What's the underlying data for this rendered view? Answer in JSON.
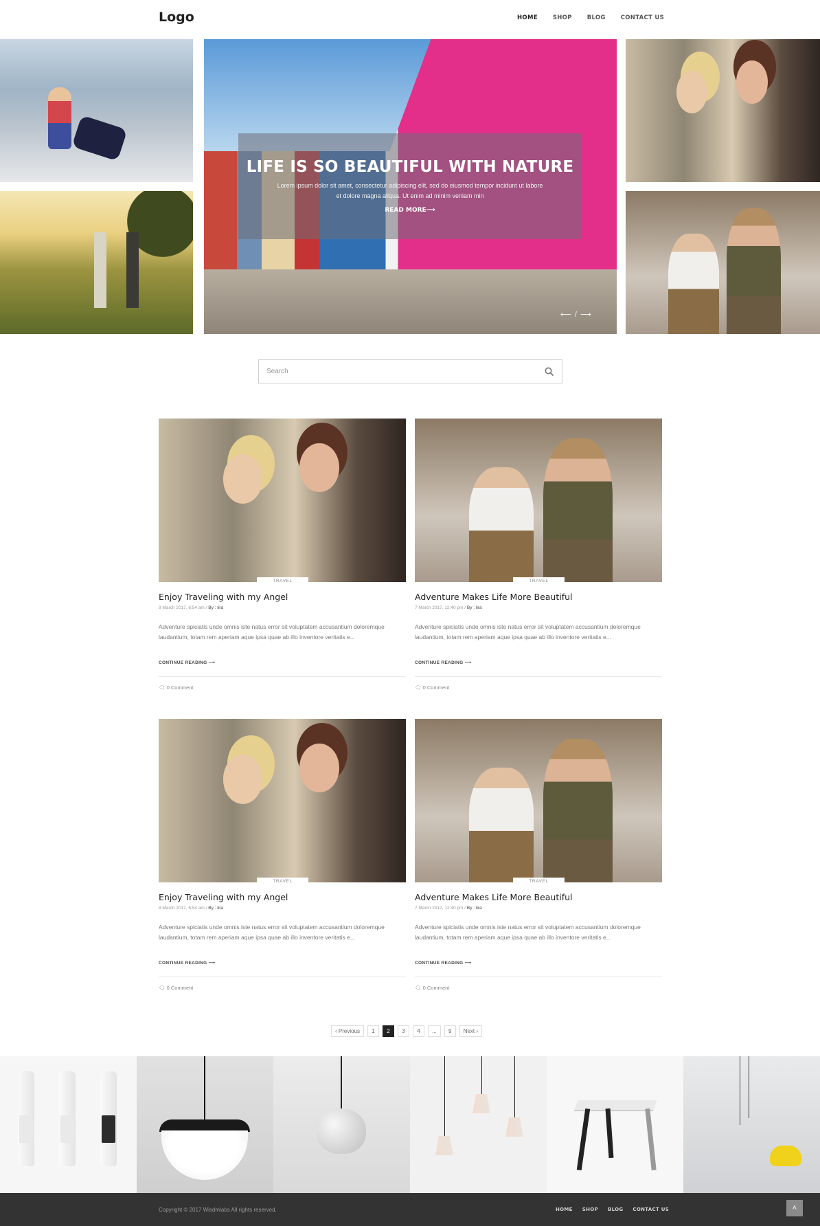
{
  "header": {
    "logo": "Logo",
    "nav": [
      "HOME",
      "SHOP",
      "BLOG",
      "CONTACT US"
    ]
  },
  "hero": {
    "title": "LIFE IS SO BEAUTIFUL WITH NATURE",
    "text": "Lorem ipsum dolor sit amet, consectetur adipiscing elit, sed do eiusmod tempor incidunt ut labore et dolore magna aliqua. Ut enim ad minim veniam min",
    "link": "READ MORE⟶",
    "arrows": "⟵ / ⟶"
  },
  "search": {
    "placeholder": "Search"
  },
  "posts": [
    {
      "tag": "TRAVEL",
      "title": "Enjoy Traveling with my Angel",
      "date": "8 March 2017, 6:54 am",
      "sep": "/",
      "by_label": "By :",
      "author": "lira",
      "excerpt": "Adventure spiciatis unde omnis iste natus error sit voluptatem accusantium doloremque laudantium, totam rem aperiam aque ipsa quae ab illo inventore veritatis e...",
      "more": "CONTINUE READING ⟶",
      "comments": "0 Comment"
    },
    {
      "tag": "TRAVEL",
      "title": "Adventure Makes Life More Beautiful",
      "date": "7 March 2017, 12:40 pm",
      "sep": "/",
      "by_label": "By :",
      "author": "lira",
      "excerpt": "Adventure spiciatis unde omnis iste natus error sit voluptatem accusantium doloremque laudantium, totam rem aperiam aque ipsa quae ab illo inventore veritatis e...",
      "more": "CONTINUE READING ⟶",
      "comments": "0 Comment"
    },
    {
      "tag": "TRAVEL",
      "title": "Enjoy Traveling with my Angel",
      "date": "8 March 2017, 6:54 am",
      "sep": "/",
      "by_label": "By :",
      "author": "lira",
      "excerpt": "Adventure spiciatis unde omnis iste natus error sit voluptatem accusantium doloremque laudantium, totam rem aperiam aque ipsa quae ab illo inventore veritatis e...",
      "more": "CONTINUE READING ⟶",
      "comments": "0 Comment"
    },
    {
      "tag": "TRAVEL",
      "title": "Adventure Makes Life More Beautiful",
      "date": "7 March 2017, 12:40 pm",
      "sep": "/",
      "by_label": "By :",
      "author": "lira",
      "excerpt": "Adventure spiciatis unde omnis iste natus error sit voluptatem accusantium doloremque laudantium, totam rem aperiam aque ipsa quae ab illo inventore veritatis e...",
      "more": "CONTINUE READING ⟶",
      "comments": "0 Comment"
    }
  ],
  "pagination": {
    "previous": "‹  Previous",
    "pages": [
      "1",
      "2",
      "3",
      "4",
      "...",
      "9"
    ],
    "current": "2",
    "next": "Next  ›"
  },
  "footer": {
    "copyright": "Copyright © 2017 Wisdmlabs All rights reserved.",
    "nav": [
      "HOME",
      "SHOP",
      "BLOG",
      "CONTACT US"
    ],
    "to_top": "˄"
  },
  "icons": {
    "comment": "comment-icon",
    "search": "search-icon",
    "to_top": "chevron-up-icon"
  }
}
